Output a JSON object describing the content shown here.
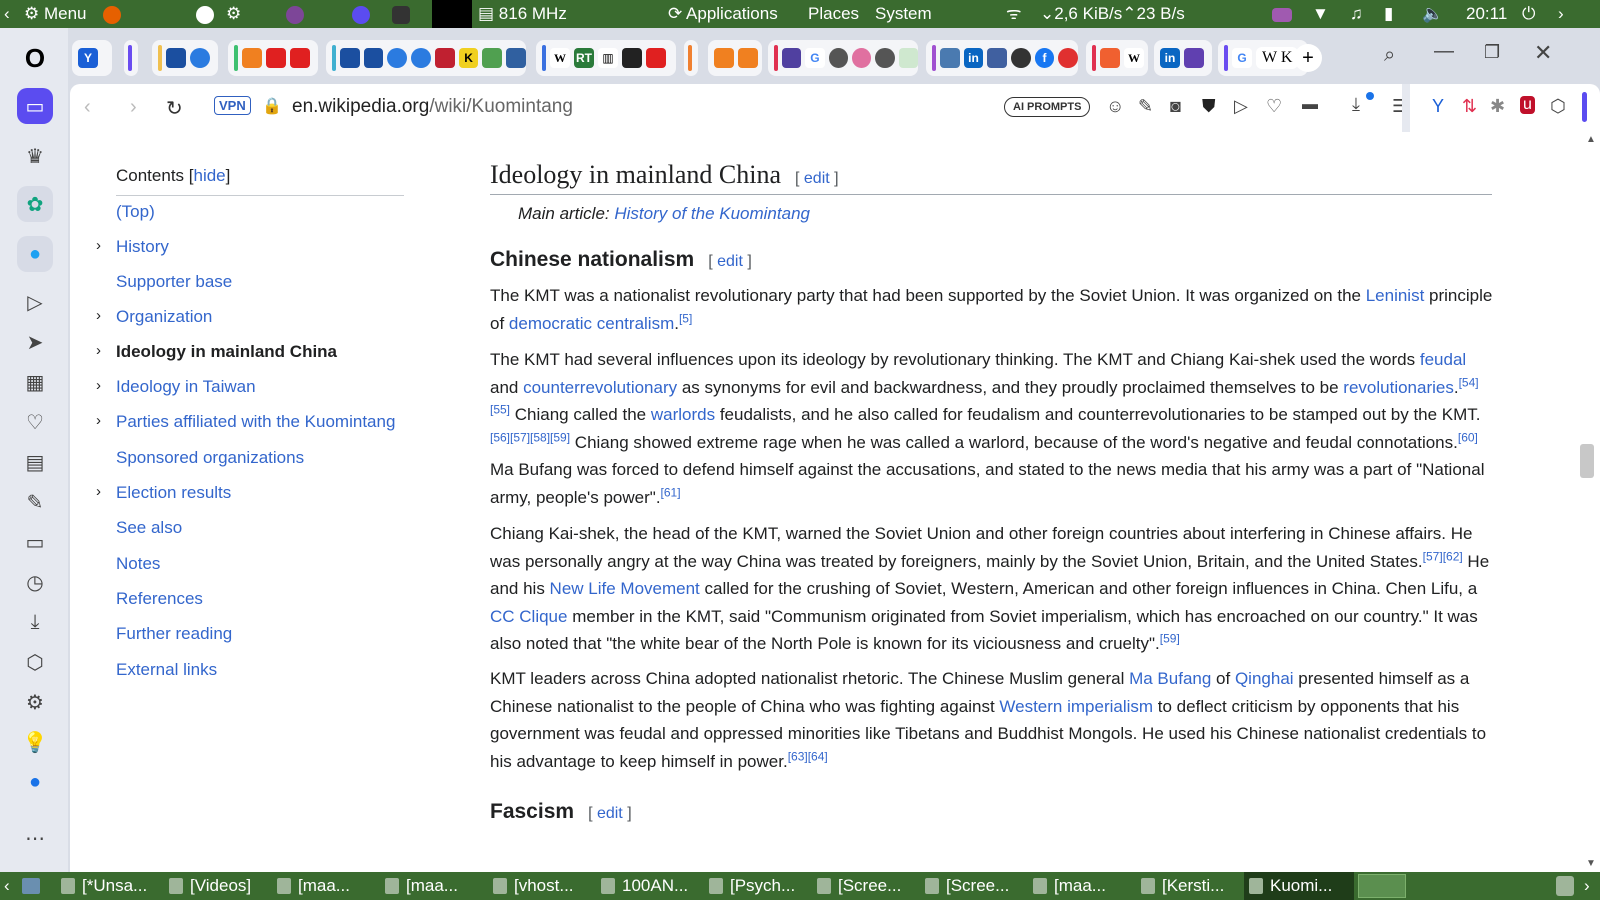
{
  "system_bar": {
    "menu_label": "Menu",
    "cpu_freq": "816 MHz",
    "applications": "Applications",
    "places": "Places",
    "system": "System",
    "net_down": "2,6 KiB/s",
    "net_up": "23 B/s",
    "clock": "20:11"
  },
  "browser": {
    "url_domain": "en.wikipedia.org",
    "url_path": "/wiki/Kuomintang",
    "vpn_label": "VPN",
    "ai_prompts_label": "AI PROMPTS",
    "active_tab_label": "W K"
  },
  "toc": {
    "title": "Contents",
    "hide_label": "hide",
    "items": [
      {
        "label": "(Top)",
        "expandable": false,
        "current": false
      },
      {
        "label": "History",
        "expandable": true,
        "current": false
      },
      {
        "label": "Supporter base",
        "expandable": false,
        "current": false
      },
      {
        "label": "Organization",
        "expandable": true,
        "current": false
      },
      {
        "label": "Ideology in mainland China",
        "expandable": true,
        "current": true
      },
      {
        "label": "Ideology in Taiwan",
        "expandable": true,
        "current": false
      },
      {
        "label": "Parties affiliated with the Kuomintang",
        "expandable": true,
        "current": false
      },
      {
        "label": "Sponsored organizations",
        "expandable": false,
        "current": false
      },
      {
        "label": "Election results",
        "expandable": true,
        "current": false
      },
      {
        "label": "See also",
        "expandable": false,
        "current": false
      },
      {
        "label": "Notes",
        "expandable": false,
        "current": false
      },
      {
        "label": "References",
        "expandable": false,
        "current": false
      },
      {
        "label": "Further reading",
        "expandable": false,
        "current": false
      },
      {
        "label": "External links",
        "expandable": false,
        "current": false
      }
    ]
  },
  "article": {
    "section_title": "Ideology in mainland China",
    "edit_label": "edit",
    "main_article_prefix": "Main article: ",
    "main_article_link": "History of the Kuomintang",
    "subsection1": "Chinese nationalism",
    "subsection2": "Fascism",
    "p1": {
      "t1": "The KMT was a nationalist revolutionary party that had been supported by the Soviet Union. It was organized on the ",
      "l1": "Leninist",
      "t2": " principle of ",
      "l2": "democratic centralism",
      "t3": ".",
      "r1": "[5]"
    },
    "p2": {
      "t1": "The KMT had several influences upon its ideology by revolutionary thinking. The KMT and Chiang Kai-shek used the words ",
      "l1": "feudal",
      "t2": " and ",
      "l2": "counterrevolutionary",
      "t3": " as synonyms for evil and backwardness, and they proudly proclaimed themselves to be ",
      "l3": "revolutionaries",
      "t4": ".",
      "r1": "[54][55]",
      "t5": " Chiang called the ",
      "l4": "warlords",
      "t6": " feudalists, and he also called for feudalism and counterrevolutionaries to be stamped out by the KMT.",
      "r2": "[56][57][58][59]",
      "t7": " Chiang showed extreme rage when he was called a warlord, because of the word's negative and feudal connotations.",
      "r3": "[60]",
      "t8": " Ma Bufang was forced to defend himself against the accusations, and stated to the news media that his army was a part of \"National army, people's power\".",
      "r4": "[61]"
    },
    "p3": {
      "t1": "Chiang Kai-shek, the head of the KMT, warned the Soviet Union and other foreign countries about interfering in Chinese affairs. He was personally angry at the way China was treated by foreigners, mainly by the Soviet Union, Britain, and the United States.",
      "r1": "[57][62]",
      "t2": " He and his ",
      "l1": "New Life Movement",
      "t3": " called for the crushing of Soviet, Western, American and other foreign influences in China. Chen Lifu, a ",
      "l2": "CC Clique",
      "t4": " member in the KMT, said \"Communism originated from Soviet imperialism, which has encroached on our country.\" It was also noted that \"the white bear of the North Pole is known for its viciousness and cruelty\".",
      "r2": "[59]"
    },
    "p4": {
      "t1": "KMT leaders across China adopted nationalist rhetoric. The Chinese Muslim general ",
      "l1": "Ma Bufang",
      "t2": " of ",
      "l2": "Qinghai",
      "t3": " presented himself as a Chinese nationalist to the people of China who was fighting against ",
      "l3": "Western imperialism",
      "t4": " to deflect criticism by opponents that his government was feudal and oppressed minorities like Tibetans and Buddhist Mongols. He used his Chinese nationalist credentials to his advantage to keep himself in power.",
      "r1": "[63][64]"
    }
  },
  "taskbar": {
    "tasks": [
      "[*Unsa...",
      "[Videos]",
      "[maa...",
      "[maa...",
      "[vhost...",
      "100AN...",
      "[Psych...",
      "[Scree...",
      "[Scree...",
      "[maa...",
      "[Kersti...",
      "Kuomi..."
    ]
  },
  "colors": {
    "panel": "#3a6b2f",
    "link": "#3366cc",
    "opera_accent": "#5b4cf0"
  }
}
